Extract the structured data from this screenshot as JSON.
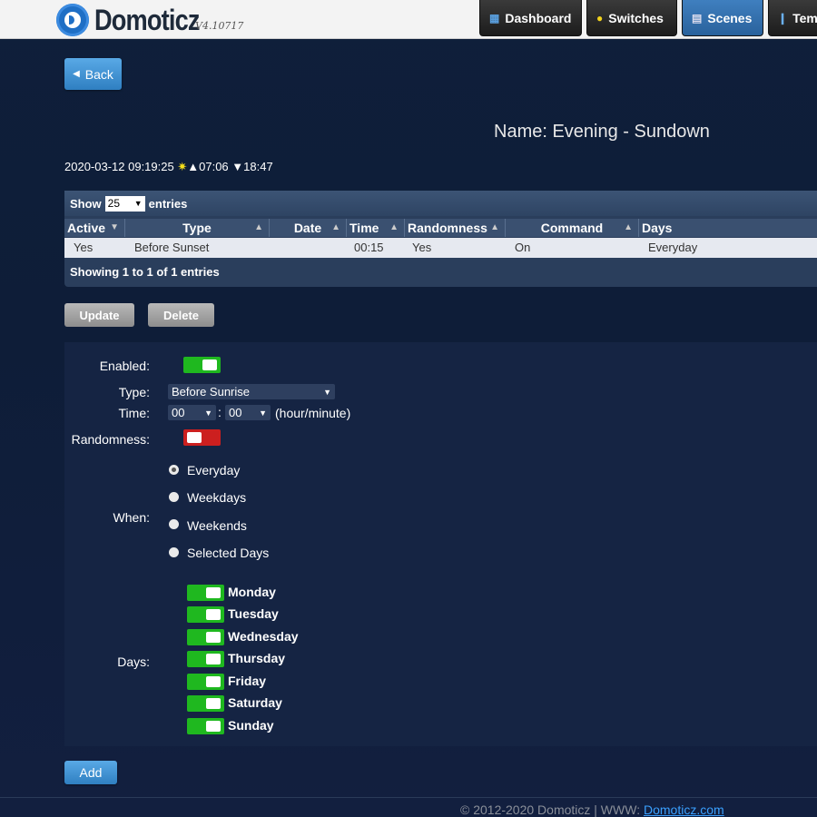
{
  "app": {
    "name": "Domoticz",
    "version": "V4.10717"
  },
  "nav": [
    {
      "label": "Dashboard",
      "icon": "dashboard-icon"
    },
    {
      "label": "Switches",
      "icon": "lightbulb-icon"
    },
    {
      "label": "Scenes",
      "icon": "scenes-icon",
      "active": true
    },
    {
      "label": "Tem",
      "icon": "thermometer-icon"
    }
  ],
  "back_label": "Back",
  "page_title": "Name: Evening - Sundown",
  "datetime": {
    "date": "2020-03-12 09:19:25",
    "sunrise": "07:06",
    "sunset": "18:47"
  },
  "table": {
    "show_label": "Show",
    "page_size": "25",
    "entries_label": "entries",
    "columns": [
      "Active",
      "Type",
      "Date",
      "Time",
      "Randomness",
      "Command",
      "Days"
    ],
    "rows": [
      {
        "active": "Yes",
        "type": "Before Sunset",
        "date": "",
        "time": "00:15",
        "randomness": "Yes",
        "command": "On",
        "days": "Everyday"
      }
    ],
    "info": "Showing 1 to 1 of 1 entries"
  },
  "actions": {
    "update": "Update",
    "delete": "Delete",
    "add": "Add"
  },
  "form": {
    "enabled_label": "Enabled:",
    "enabled": true,
    "type_label": "Type:",
    "type_value": "Before Sunrise",
    "time_label": "Time:",
    "hour": "00",
    "minute": "00",
    "time_separator": ":",
    "time_unit": "(hour/minute)",
    "randomness_label": "Randomness:",
    "randomness": false,
    "when_label": "When:",
    "when_options": [
      "Everyday",
      "Weekdays",
      "Weekends",
      "Selected Days"
    ],
    "when_selected": "Everyday",
    "days_label": "Days:",
    "days": [
      "Monday",
      "Tuesday",
      "Wednesday",
      "Thursday",
      "Friday",
      "Saturday",
      "Sunday"
    ]
  },
  "footer": {
    "text": "© 2012-2020 Domoticz | WWW:",
    "link": "Domoticz.com"
  },
  "colors": {
    "accent_blue": "#2f7fc1",
    "toggle_on": "#1fb81f",
    "toggle_off": "#cc1f1f",
    "background": "#0f1f3a"
  }
}
